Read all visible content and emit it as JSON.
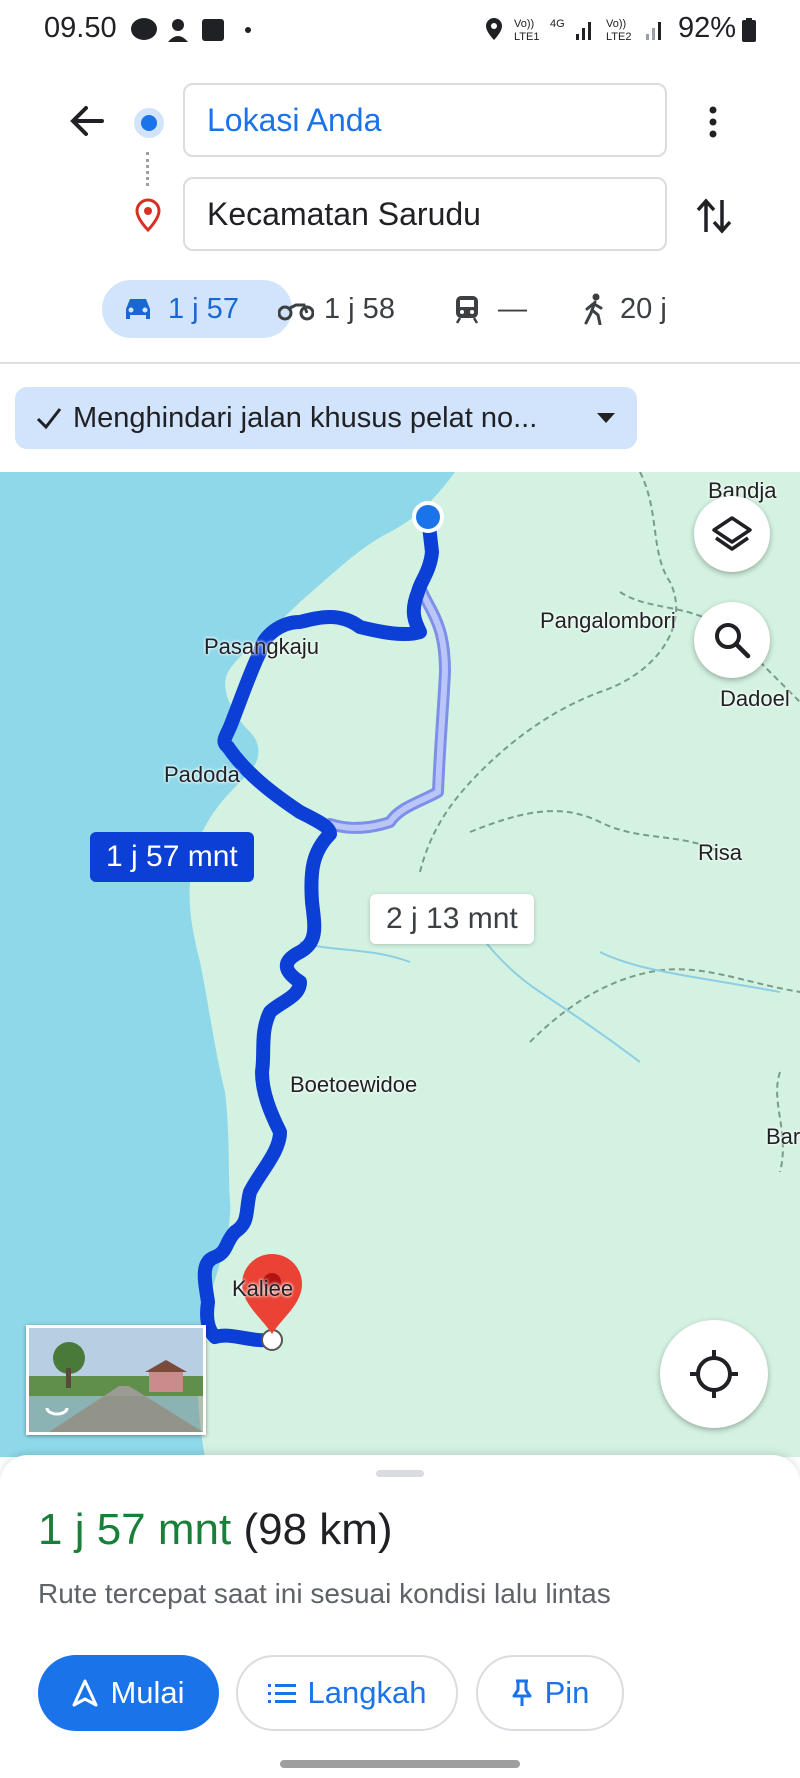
{
  "status_bar": {
    "time": "09.50",
    "battery": "92%"
  },
  "header": {
    "origin": "Lokasi Anda",
    "destination": "Kecamatan Sarudu"
  },
  "modes": [
    {
      "icon": "car-icon",
      "label": "1 j 57"
    },
    {
      "icon": "motorcycle-icon",
      "label": "1 j 58"
    },
    {
      "icon": "transit-icon",
      "label": "—"
    },
    {
      "icon": "walk-icon",
      "label": "20 j"
    }
  ],
  "route_option_chip": "Menghindari jalan khusus pelat no...",
  "map": {
    "places": [
      "Bandja",
      "Pangalombori",
      "Dadoel",
      "Pasangkaju",
      "Padoda",
      "Risa",
      "Boetoewidoe",
      "Bar",
      "Kaliee"
    ],
    "route_main_label": "1 j 57 mnt",
    "route_alt_label": "2 j 13 mnt"
  },
  "sheet": {
    "duration": "1 j 57 mnt",
    "distance": "(98 km)",
    "subtitle": "Rute tercepat saat ini sesuai kondisi lalu lintas",
    "start_label": "Mulai",
    "steps_label": "Langkah",
    "pin_label": "Pin"
  },
  "colors": {
    "accent": "#1a73e8",
    "route": "#0b3fd6",
    "duration_green": "#188038",
    "water": "#8fd8ea",
    "land": "#d4f2e1"
  }
}
